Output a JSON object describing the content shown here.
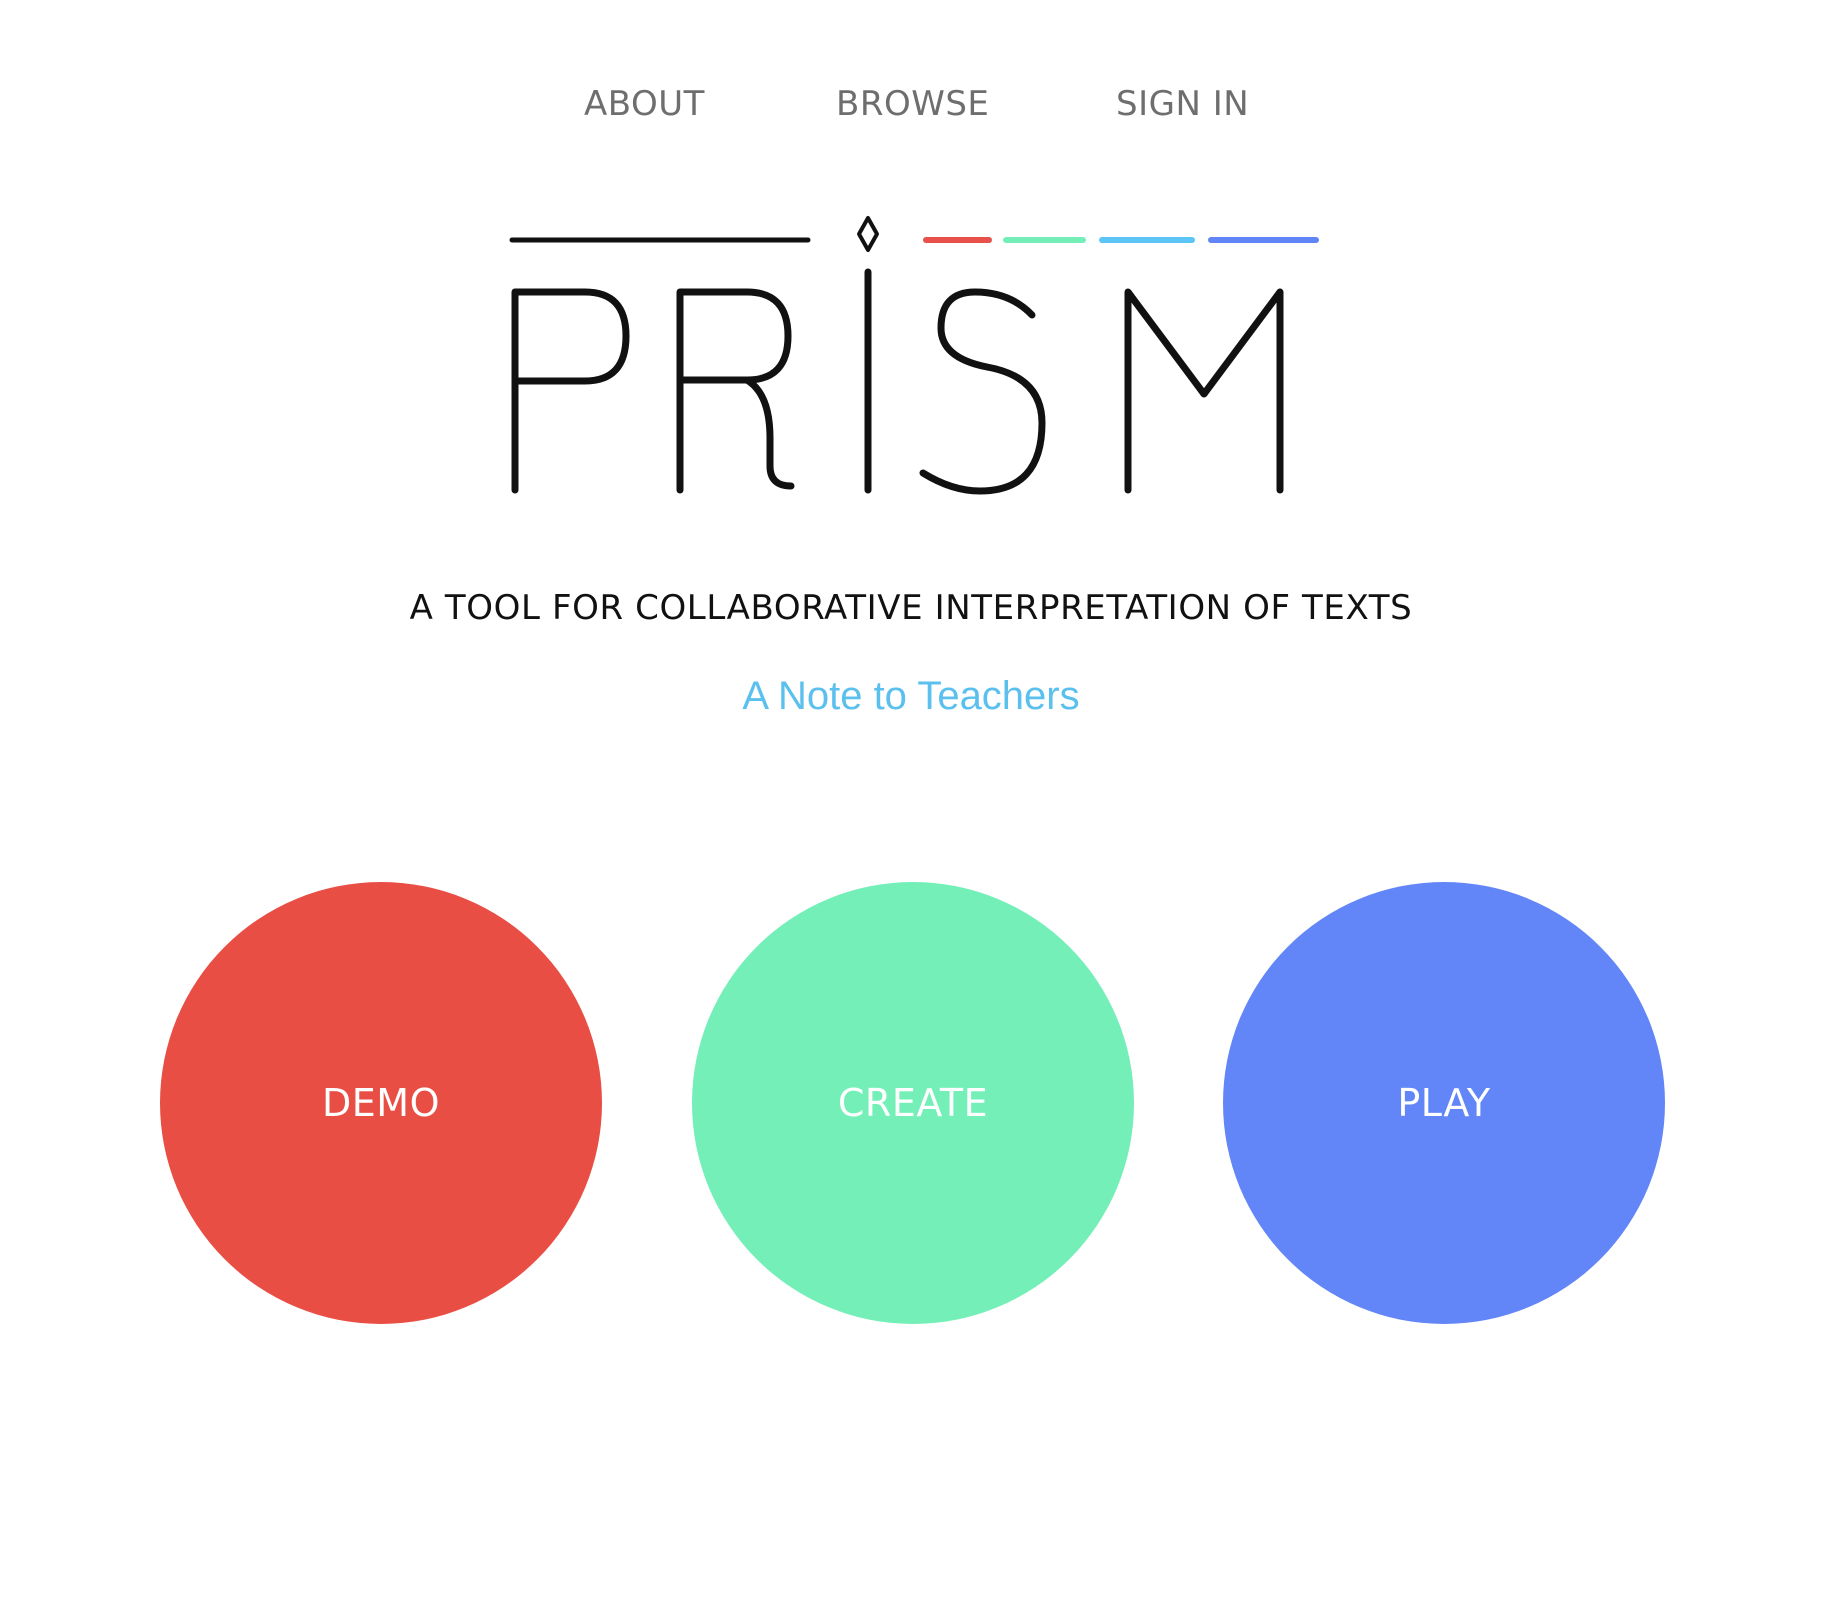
{
  "nav": {
    "about": "ABOUT",
    "browse": "BROWSE",
    "sign_in": "SIGN IN"
  },
  "logo": {
    "text": "PRISM",
    "bar_colors": [
      "#e8504a",
      "#74efb8",
      "#5bc5f5",
      "#6185f6"
    ],
    "ink_color": "#111111"
  },
  "tagline": "A TOOL FOR COLLABORATIVE INTERPRETATION OF TEXTS",
  "teacher_note": {
    "label": "A Note to Teachers",
    "color": "#5bc0ee"
  },
  "actions": [
    {
      "label": "DEMO",
      "color": "#e94e45"
    },
    {
      "label": "CREATE",
      "color": "#74efb8"
    },
    {
      "label": "PLAY",
      "color": "#6286f7"
    }
  ]
}
